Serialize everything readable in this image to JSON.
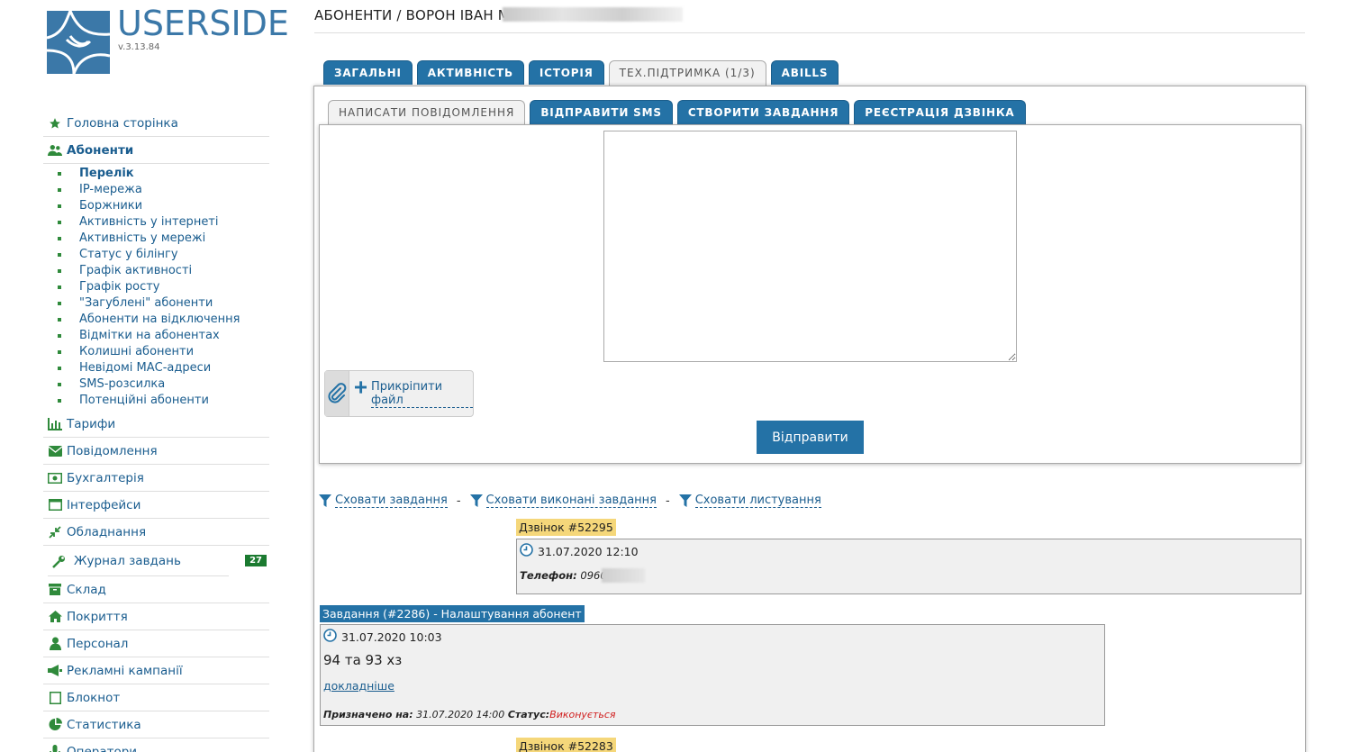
{
  "brand": {
    "name": "USERSIDE",
    "version": "v.3.13.84",
    "color": "#3b78a8"
  },
  "sidebar": {
    "items": [
      {
        "key": "home",
        "icon": "star-icon",
        "label": "Головна сторінка"
      },
      {
        "key": "subscribers",
        "icon": "users-icon",
        "label": "Абоненти"
      },
      {
        "key": "tariffs",
        "icon": "bar-chart-icon",
        "label": "Тарифи"
      },
      {
        "key": "messages",
        "icon": "envelope-icon",
        "label": "Повідомлення"
      },
      {
        "key": "accounting",
        "icon": "money-icon",
        "label": "Бухгалтерія"
      },
      {
        "key": "interfaces",
        "icon": "window-icon",
        "label": "Інтерфейси"
      },
      {
        "key": "equipment",
        "icon": "compress-icon",
        "label": "Обладнання"
      },
      {
        "key": "tasks",
        "icon": "wrench-icon",
        "label": "Журнал завдань",
        "badge": "27"
      },
      {
        "key": "warehouse",
        "icon": "archive-icon",
        "label": "Склад"
      },
      {
        "key": "coverage",
        "icon": "home-icon",
        "label": "Покриття"
      },
      {
        "key": "staff",
        "icon": "staff-icon",
        "label": "Персонал"
      },
      {
        "key": "ads",
        "icon": "megaphone-icon",
        "label": "Рекламні кампанії"
      },
      {
        "key": "notes",
        "icon": "note-icon",
        "label": "Блокнот"
      },
      {
        "key": "stats",
        "icon": "pie-chart-icon",
        "label": "Статистика"
      },
      {
        "key": "operators",
        "icon": "mic-icon",
        "label": "Оператори"
      }
    ],
    "subscribers_submenu": [
      "Перелік",
      "IP-мережа",
      "Боржники",
      "Активність у інтернеті",
      "Активність у мережі",
      "Статус у білінгу",
      "Графік активності",
      "Графік росту",
      "\"Загублені\" абоненти",
      "Абоненти на відключення",
      "Відмітки на абонентах",
      "Колишні абоненти",
      "Невідомі МАС-адреси",
      "SMS-розсилка",
      "Потенційні абоненти"
    ]
  },
  "header": {
    "title": "АБОНЕНТИ / ВОРОН ІВАН М"
  },
  "tabs": [
    "ЗАГАЛЬНІ",
    "АКТИВНІСТЬ",
    "ІСТОРІЯ",
    "ТЕХ.ПІДТРИМКА (1/3)",
    "ABILLS"
  ],
  "active_tab_index": 3,
  "subtabs": [
    "НАПИСАТИ ПОВІДОМЛЕННЯ",
    "ВІДПРАВИТИ SMS",
    "СТВОРИТИ ЗАВДАННЯ",
    "РЕЄСТРАЦІЯ ДЗВІНКА"
  ],
  "active_subtab_index": 0,
  "compose": {
    "message_value": "",
    "attach_label": "Прикріпити файл",
    "send_label": "Відправити"
  },
  "filters": {
    "hide_tasks": "Сховати завдання",
    "hide_done": "Сховати виконані завдання",
    "hide_mail": "Сховати листування",
    "separator": "-"
  },
  "feed": {
    "call1": {
      "label": "Дзвінок #52295",
      "datetime": "31.07.2020 12:10",
      "phone_label": "Телефон:",
      "phone_value": "0960"
    },
    "task1": {
      "label": "Завдання (#2286) - Налаштування абонент",
      "datetime": "31.07.2020 10:03",
      "text": "94 та 93 хз",
      "more": "докладніше",
      "assigned_label": "Призначено на:",
      "assigned_value": "31.07.2020 14:00",
      "status_label": "Статус:",
      "status_value": "Виконується",
      "status_color": "#d01d1d"
    },
    "call2": {
      "label": "Дзвінок #52283"
    }
  },
  "colors": {
    "primary": "#2472a6",
    "link": "#1a5d8f",
    "call_label_bg": "#f5d77a",
    "submenu_bullet": "#2f8a3b",
    "badge_bg": "#1b7a30"
  }
}
